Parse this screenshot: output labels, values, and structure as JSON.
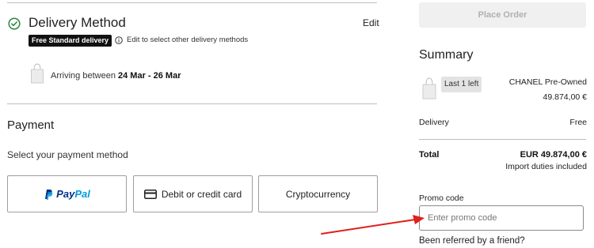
{
  "delivery": {
    "title": "Delivery Method",
    "edit_label": "Edit",
    "badge": "Free Standard delivery",
    "info_text": "Edit to select other delivery methods",
    "arriving_prefix": "Arriving between ",
    "arriving_dates": "24 Mar - 26 Mar",
    "check_icon": "check-circle-icon"
  },
  "payment": {
    "title": "Payment",
    "subtitle": "Select your payment method",
    "options": {
      "paypal_pay": "Pay",
      "paypal_pal": "Pal",
      "card": "Debit or credit card",
      "crypto": "Cryptocurrency"
    }
  },
  "order": {
    "place_order_label": "Place Order"
  },
  "summary": {
    "title": "Summary",
    "last_left": "Last 1 left",
    "brand": "CHANEL Pre-Owned",
    "item_price": "49.874,00 €",
    "delivery_label": "Delivery",
    "delivery_value": "Free",
    "total_label": "Total",
    "total_value": "EUR 49.874,00 €",
    "import_duties": "Import duties included"
  },
  "promo": {
    "label": "Promo code",
    "placeholder": "Enter promo code",
    "value": ""
  },
  "referral": {
    "text": "Been referred by a friend?"
  },
  "colors": {
    "accent_green": "#2e8540",
    "badge_bg": "#111111",
    "annotation_arrow": "#e0201c"
  }
}
